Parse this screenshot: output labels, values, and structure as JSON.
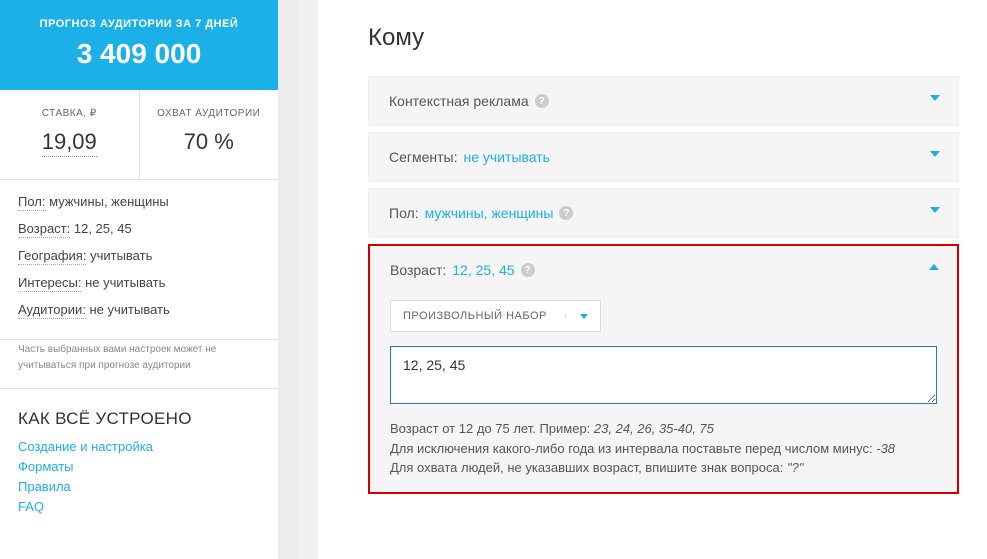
{
  "sidebar": {
    "forecast": {
      "label": "ПРОГНОЗ АУДИТОРИИ ЗА 7 ДНЕЙ",
      "value": "3 409 000"
    },
    "stats": {
      "rate": {
        "label": "СТАВКА, ₽",
        "value": "19,09"
      },
      "reach": {
        "label": "ОХВАТ АУДИТОРИИ",
        "value": "70 %"
      }
    },
    "filters": {
      "gender": {
        "key": "Пол:",
        "value": "мужчины, женщины"
      },
      "age": {
        "key": "Возраст:",
        "value": "12, 25, 45"
      },
      "geo": {
        "key": "География:",
        "value": "учитывать"
      },
      "interests": {
        "key": "Интересы:",
        "value": "не учитывать"
      },
      "audiences": {
        "key": "Аудитории:",
        "value": "не учитывать"
      }
    },
    "note": "Часть выбранных вами настроек может не учитываться при прогнозе аудитории",
    "how": {
      "title": "КАК ВСЁ УСТРОЕНО",
      "links": {
        "create": "Создание и настройка",
        "formats": "Форматы",
        "rules": "Правила",
        "faq": "FAQ"
      }
    }
  },
  "main": {
    "title": "Кому",
    "sections": {
      "context": {
        "label": "Контекстная реклама"
      },
      "segments": {
        "label": "Сегменты:",
        "value": "не учитывать"
      },
      "gender": {
        "label": "Пол:",
        "value": "мужчины, женщины"
      },
      "age": {
        "label": "Возраст:",
        "value": "12, 25, 45",
        "dropdown": "ПРОИЗВОЛЬНЫЙ НАБОР",
        "input_value": "12, 25, 45",
        "hint1_a": "Возраст от 12 до 75 лет. Пример: ",
        "hint1_b": "23, 24, 26, 35-40, 75",
        "hint2_a": "Для исключения какого-либо года из интервала поставьте перед числом минус: ",
        "hint2_b": "-38",
        "hint3_a": "Для охвата людей, не указавших возраст, впишите знак вопроса: ",
        "hint3_b": "\"?\""
      }
    }
  }
}
